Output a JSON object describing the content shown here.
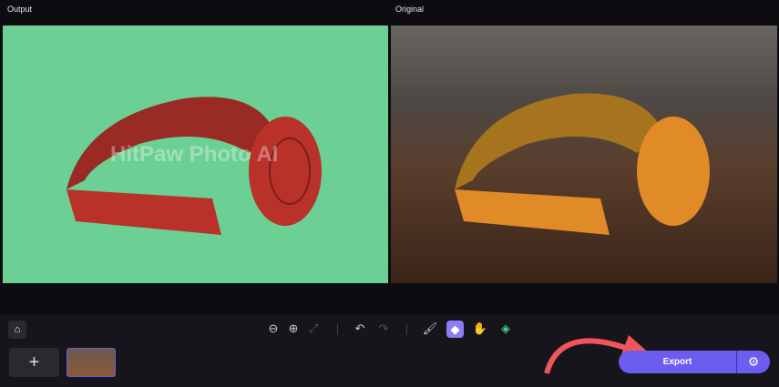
{
  "labels": {
    "output": "Output",
    "original": "Original"
  },
  "watermark": "HitPaw Photo AI",
  "toolbar": {
    "icons": [
      "home-icon",
      "zoom-out-icon",
      "zoom-in-icon",
      "fit-icon",
      "undo-icon",
      "redo-icon",
      "brush-icon",
      "eraser-icon",
      "hand-icon",
      "fill-icon"
    ],
    "active": "eraser-icon"
  },
  "footer": {
    "add": "+",
    "export": "Export"
  },
  "colors": {
    "accent": "#6c5cf0",
    "output_bg": "#6ccf94",
    "arrow": "#f0555a"
  }
}
